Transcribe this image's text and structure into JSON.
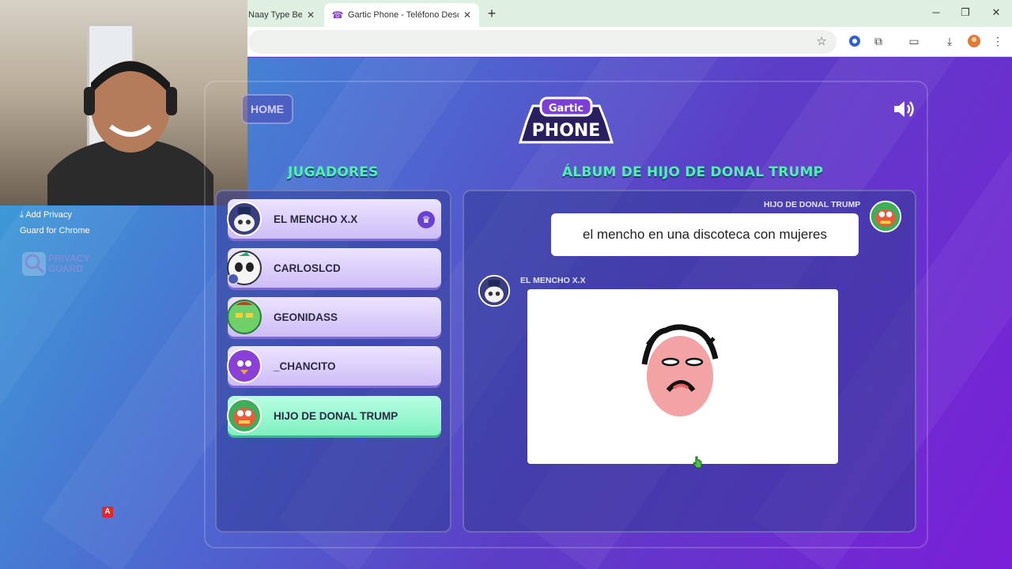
{
  "browser": {
    "tabs": [
      {
        "title": "Naay Type Beat",
        "active": false
      },
      {
        "title": "Gartic Phone - Teléfono Descon",
        "active": true
      }
    ]
  },
  "sidebar_promo": {
    "line1": "Add Privacy",
    "line2": "Guard for Chrome",
    "logo_line1": "PRIVACY",
    "logo_line2": "GUARD",
    "badge": "A"
  },
  "game": {
    "home_label": "HOME",
    "logo_top": "Gartic",
    "logo_bottom": "PHONE",
    "players_title": "JUGADORES",
    "album_title": "ÁLBUM DE HIJO DE DONAL TRUMP",
    "players": [
      {
        "name": "EL MENCHO X.X",
        "host": true
      },
      {
        "name": "CARLOSLCD"
      },
      {
        "name": "GEONIDASS"
      },
      {
        "name": "_CHANCITO"
      },
      {
        "name": "HIJO DE DONAL TRUMP",
        "highlighted": true
      }
    ],
    "album": {
      "text_author": "HIJO DE DONAL TRUMP",
      "text_message": "el mencho en una discoteca con mujeres",
      "drawing_author": "EL MENCHO X.X"
    }
  },
  "colors": {
    "accent_green": "#4ff0b0",
    "card_purple": "#cdbdf6",
    "highlight_green": "#7ff0c0"
  }
}
